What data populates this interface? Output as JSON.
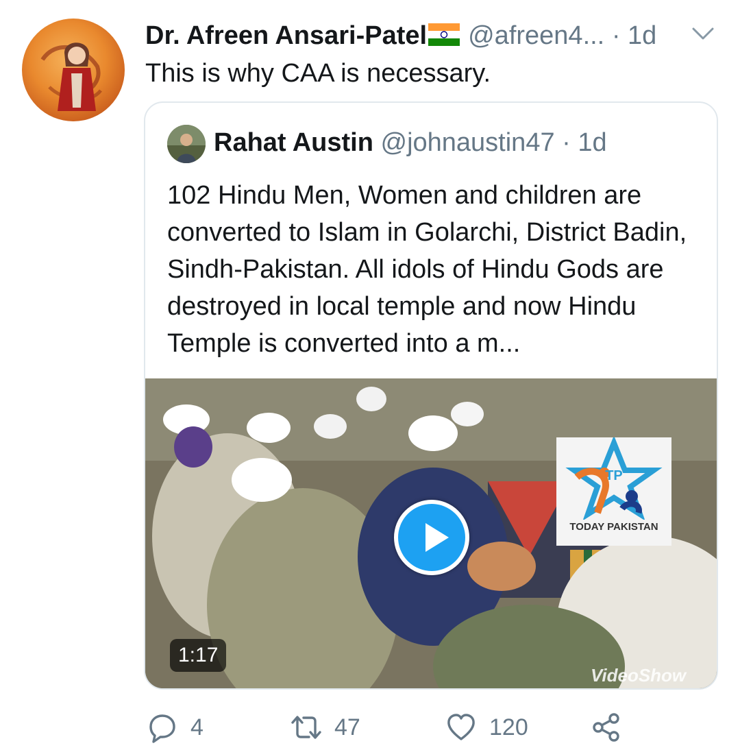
{
  "tweet": {
    "author_name": "Dr. Afreen Ansari-Patel",
    "author_handle": "@afreen4...",
    "separator": "·",
    "time": "1d",
    "text": "This is why CAA is necessary."
  },
  "quoted_tweet": {
    "author_name": "Rahat Austin",
    "author_handle": "@johnaustin47",
    "separator": "·",
    "time": "1d",
    "text": "102 Hindu Men, Women and children are converted to Islam in Golarchi, District Badin, Sindh-Pakistan. All idols of Hindu Gods are destroyed in local temple and now Hindu Temple is converted into a m...",
    "video": {
      "duration": "1:17",
      "logo_text": "TODAY PAKISTAN",
      "logo_initials": "TP",
      "watermark": "VideoShow"
    }
  },
  "actions": {
    "reply_count": "4",
    "retweet_count": "47",
    "like_count": "120"
  },
  "colors": {
    "accent": "#1da1f2",
    "secondary_text": "#657786",
    "border": "#e1e8ed"
  },
  "icons": [
    "chevron-down-icon",
    "reply-icon",
    "retweet-icon",
    "like-icon",
    "share-icon",
    "play-icon",
    "india-flag-icon"
  ]
}
